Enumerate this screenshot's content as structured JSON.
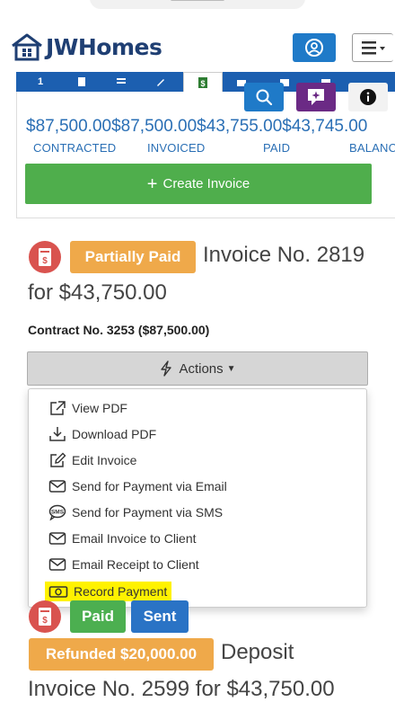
{
  "header": {
    "brand": "JWHomes"
  },
  "tabs": [
    {
      "label": "1",
      "icon": "number-icon"
    },
    {
      "label": "",
      "icon": "document-icon"
    },
    {
      "label": "",
      "icon": "list-icon"
    },
    {
      "label": "",
      "icon": "edit-icon"
    },
    {
      "label": "",
      "icon": "invoice-icon"
    },
    {
      "label": "",
      "icon": "briefcase-icon"
    },
    {
      "label": "",
      "icon": "camera-icon"
    },
    {
      "label": "",
      "icon": "folder-icon"
    }
  ],
  "summary": {
    "values": "$87,500.00$87,500.00$43,755.00$43,745.00",
    "labels": {
      "contracted": "CONTRACTED",
      "invoiced": "INVOICED",
      "paid": "PAID",
      "balance": "BALANCE"
    },
    "create_button": "Create Invoice"
  },
  "invoice": {
    "status": "Partially Paid",
    "title_line1": "Invoice No. 2819",
    "title_line2": "for $43,750.00",
    "contract": "Contract No. 3253 ($87,500.00)",
    "actions_label": "Actions"
  },
  "menu": {
    "items": [
      {
        "label": "View PDF",
        "icon": "external-link-icon"
      },
      {
        "label": "Download PDF",
        "icon": "download-icon"
      },
      {
        "label": "Edit Invoice",
        "icon": "edit-icon"
      },
      {
        "label": "Send for Payment via Email",
        "icon": "envelope-icon"
      },
      {
        "label": "Send for Payment via SMS",
        "icon": "sms-icon"
      },
      {
        "label": "Email Invoice to Client",
        "icon": "envelope-icon"
      },
      {
        "label": "Email Receipt to Client",
        "icon": "envelope-icon"
      },
      {
        "label": "Record Payment",
        "icon": "money-icon",
        "highlight": "#fff200"
      }
    ]
  },
  "next_invoice": {
    "badge_paid": "Paid",
    "badge_sent": "Sent",
    "badge_refunded": "Refunded $20,000.00",
    "title_suffix": "Deposit",
    "title_line2": "Invoice No. 2599 for $43,750.00"
  },
  "colors": {
    "brand_navy": "#1f3f73",
    "primary_blue": "#1f7ac8",
    "success_green": "#4fae4c",
    "warning_orange": "#efa94a",
    "danger_red": "#d9534f",
    "highlight_yellow": "#fff200"
  }
}
